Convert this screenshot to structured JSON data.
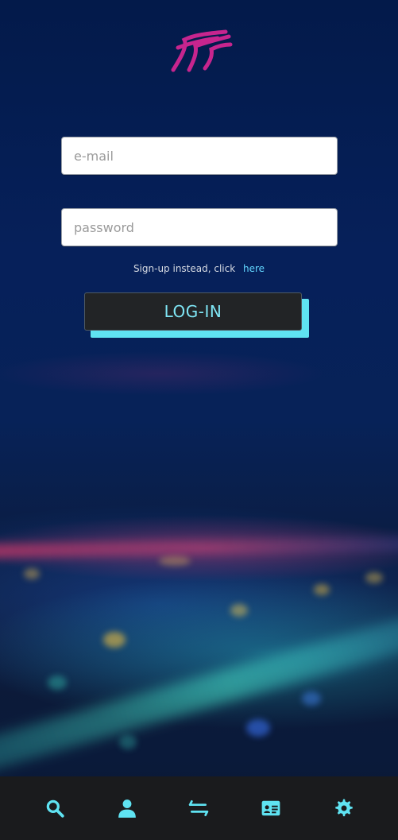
{
  "accent_color": "#5fe3f2",
  "logo": {
    "icon": "wing-logo-icon",
    "color": "#c7258e"
  },
  "form": {
    "email_placeholder": "e-mail",
    "password_placeholder": "password",
    "signup_text": "Sign-up instead, click",
    "signup_link": "here",
    "login_label": "LOG-IN"
  },
  "nav": {
    "items": [
      {
        "icon": "search-icon"
      },
      {
        "icon": "user-icon"
      },
      {
        "icon": "transfer-arrows-icon"
      },
      {
        "icon": "id-card-icon"
      },
      {
        "icon": "gear-icon"
      }
    ]
  }
}
